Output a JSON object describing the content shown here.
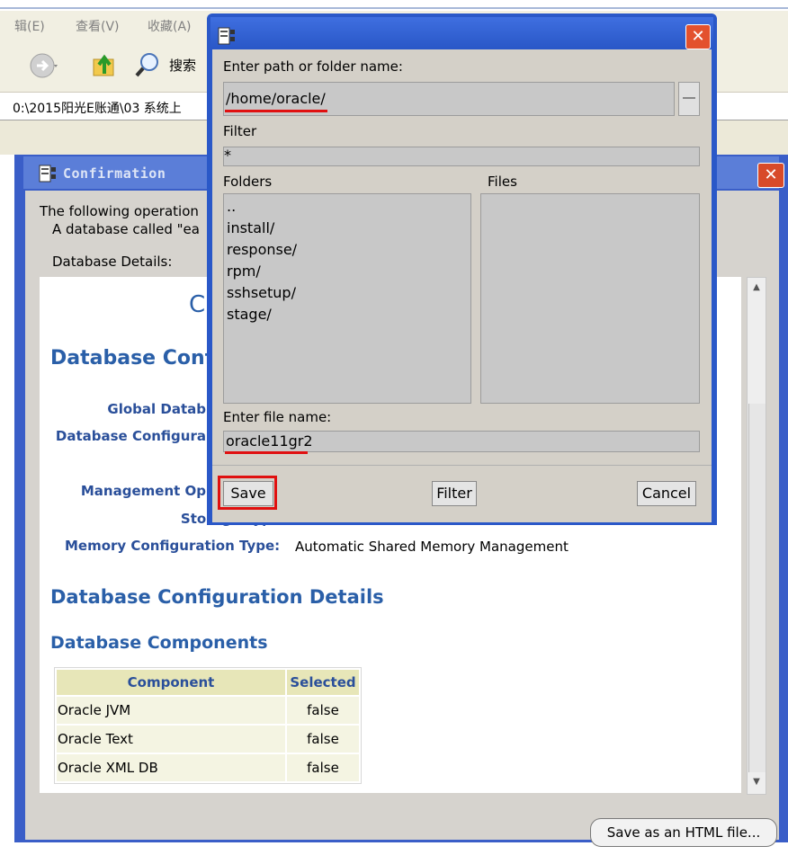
{
  "explorer": {
    "menu": [
      "辑(E)",
      "查看(V)",
      "收藏(A)"
    ],
    "search_label": "搜索",
    "address": "0:\\2015阳光E账通\\03 系统上"
  },
  "confirmation": {
    "title": "Confirmation",
    "line1": "The following operation",
    "line2": "A database called \"ea",
    "details_label": "Database Details:",
    "content_heading_fragment": "C",
    "section1": "Database Conf",
    "labels": {
      "global_db": "Global Datab",
      "db_config": "Database Configura",
      "management": "Management Op",
      "storage": "Storage Type:",
      "memory": "Memory Configuration Type:"
    },
    "memory_value": "Automatic Shared Memory Management",
    "section2": "Database Configuration Details",
    "section3": "Database Components",
    "table": {
      "headers": [
        "Component",
        "Selected"
      ],
      "rows": [
        [
          "Oracle JVM",
          "false"
        ],
        [
          "Oracle Text",
          "false"
        ],
        [
          "Oracle XML DB",
          "false"
        ]
      ]
    },
    "save_html_button": "Save as an HTML file..."
  },
  "save_dialog": {
    "path_label": "Enter path or folder name:",
    "path_value": "/home/oracle/",
    "filter_label": "Filter",
    "filter_value": "*",
    "folders_label": "Folders",
    "files_label": "Files",
    "folders": [
      "..",
      "install/",
      "response/",
      "rpm/",
      "sshsetup/",
      "stage/"
    ],
    "file_name_label": "Enter file name:",
    "file_name_value": "oracle11gr2",
    "buttons": {
      "save": "Save",
      "filter": "Filter",
      "cancel": "Cancel"
    },
    "highlight_color": "#e01010"
  }
}
